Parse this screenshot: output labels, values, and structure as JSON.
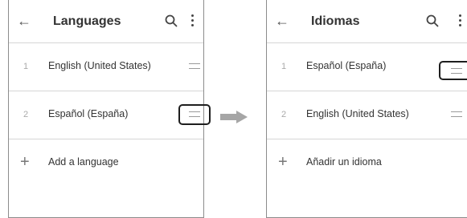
{
  "colors": {
    "arrow": "#a6a6a6",
    "highlight_border": "#1e1e1e",
    "divider": "#d6d6d6"
  },
  "left_screen": {
    "title": "Languages",
    "languages": [
      {
        "index": "1",
        "label": "English (United States)"
      },
      {
        "index": "2",
        "label": "Español (España)"
      }
    ],
    "add_label": "Add a language",
    "highlighted_item_index": "2"
  },
  "right_screen": {
    "title": "Idiomas",
    "languages": [
      {
        "index": "1",
        "label": "Español (España)"
      },
      {
        "index": "2",
        "label": "English (United States)"
      }
    ],
    "add_label": "Añadir un idioma",
    "highlighted_item_index": "1"
  },
  "icons": {
    "back": "arrow-left",
    "search": "magnifier",
    "more": "vertical-dots",
    "drag": "drag-handle",
    "add": "plus",
    "transition": "right-arrow"
  }
}
